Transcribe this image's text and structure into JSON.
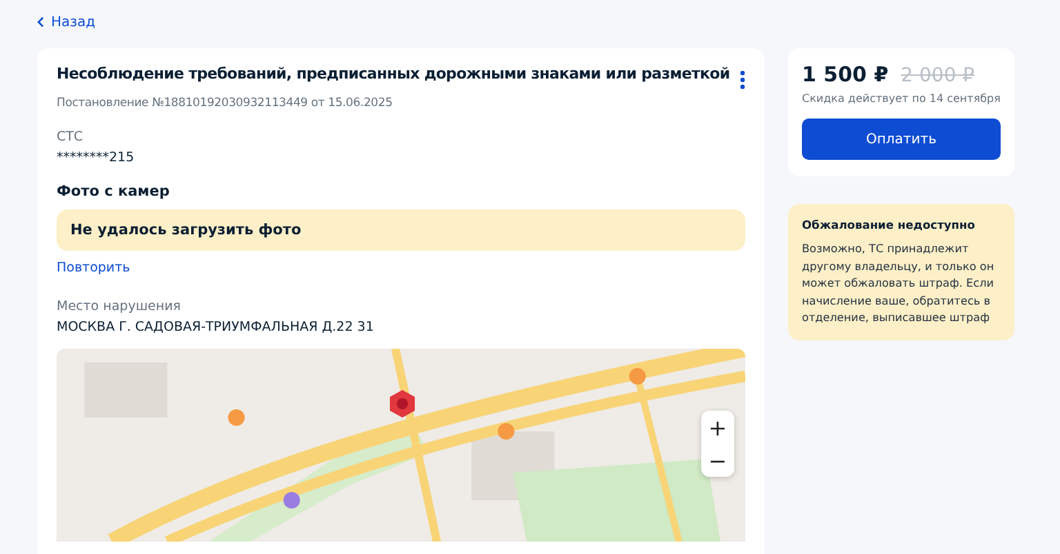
{
  "back_link": {
    "label": "Назад"
  },
  "fine": {
    "title": "Несоблюдение требований, предписанных дорожными знаками или разметкой",
    "subtitle": "Постановление №18810192030932113449 от 15.06.2025",
    "document": {
      "label": "СТС",
      "value": "********215"
    },
    "photos": {
      "heading": "Фото с камер",
      "error": "Не удалось загрузить фото",
      "retry": "Повторить"
    },
    "place": {
      "label": "Место нарушения",
      "value": "МОСКВА Г. САДОВАЯ-ТРИУМФАЛЬНАЯ Д.22 31"
    },
    "map": {
      "kind": "picture",
      "zoom_in": "+",
      "zoom_out": "−"
    }
  },
  "payment": {
    "price": "1 500 ₽",
    "old_price": "2 000 ₽",
    "discount_note": "Скидка действует по 14 сентября",
    "pay_button": "Оплатить"
  },
  "notice": {
    "title": "Обжалование недоступно",
    "text": "Возможно, ТС принадлежит другому владельцу, и только он может обжаловать штраф. Если начисление ваше, обратитесь в отделение, выписавшее штраф"
  }
}
